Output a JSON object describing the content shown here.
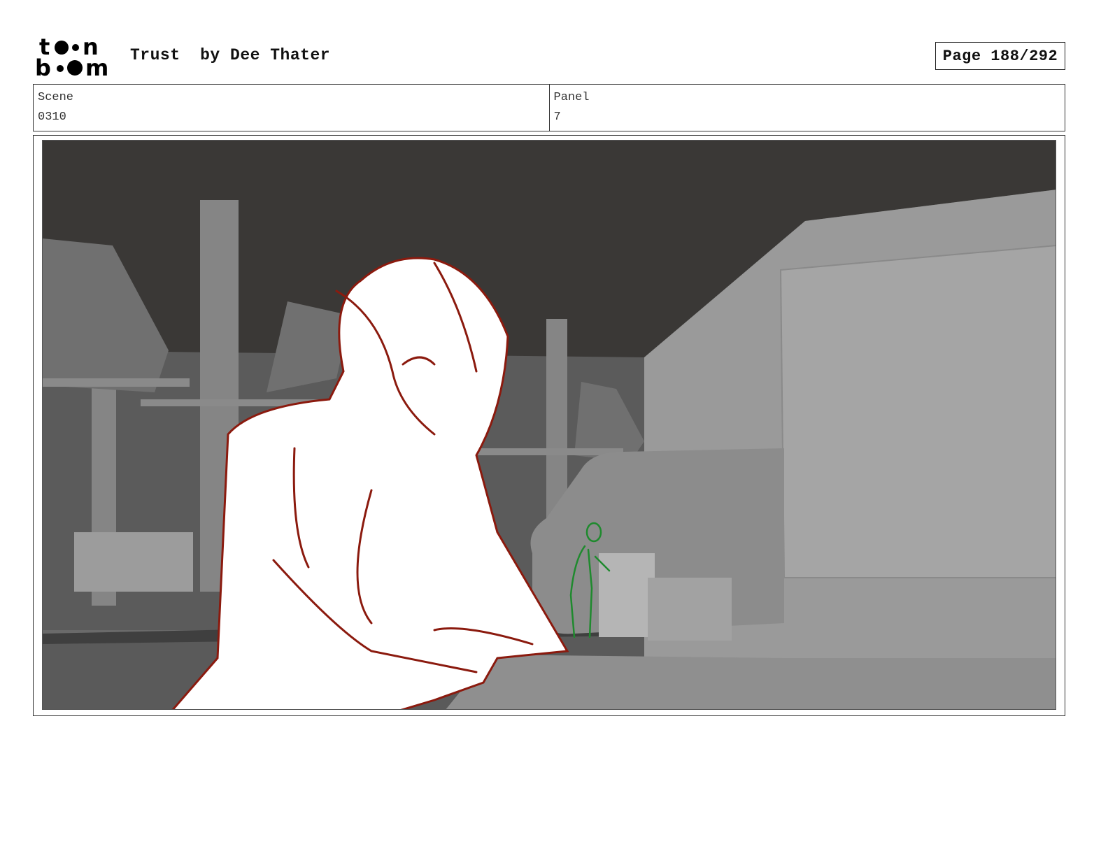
{
  "header": {
    "logo_text": "toon boom",
    "title": "Trust  by Dee Thater",
    "page": "Page 188/292"
  },
  "info": {
    "scene_label": "Scene",
    "scene_value": "0310",
    "panel_label": "Panel",
    "panel_value": "7"
  },
  "colors": {
    "sketch_red": "#8b1a0e",
    "sketch_green": "#1f8a2e",
    "ceiling": "#3a3836",
    "wall": "#9a9a9a"
  }
}
